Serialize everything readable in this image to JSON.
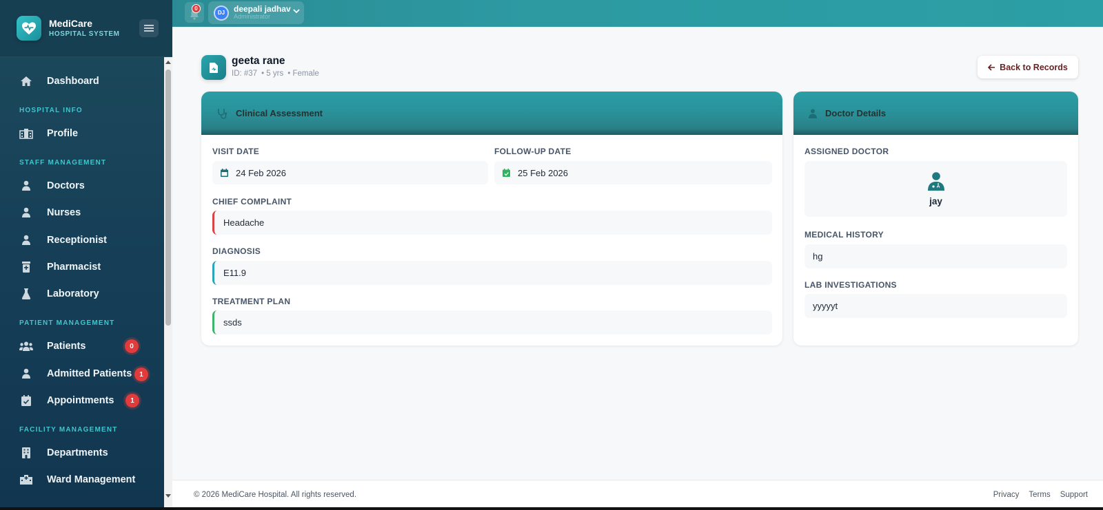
{
  "brand": {
    "name": "MediCare",
    "subtitle": "HOSPITAL SYSTEM"
  },
  "sidebar": {
    "dashboard": "Dashboard",
    "sections": {
      "hospital_info": "HOSPITAL INFO",
      "staff": "STAFF MANAGEMENT",
      "patient": "PATIENT MANAGEMENT",
      "facility": "FACILITY MANAGEMENT"
    },
    "items": {
      "profile": "Profile",
      "doctors": "Doctors",
      "nurses": "Nurses",
      "receptionist": "Receptionist",
      "pharmacist": "Pharmacist",
      "laboratory": "Laboratory",
      "patients": "Patients",
      "admitted": "Admitted Patients",
      "appointments": "Appointments",
      "departments": "Departments",
      "ward": "Ward Management"
    },
    "badges": {
      "patients": "0",
      "admitted": "1",
      "appointments": "1"
    }
  },
  "topbar": {
    "notification_count": "0",
    "user_initials": "DJ",
    "user_name": "deepali jadhav",
    "user_role": "Administrator"
  },
  "patient": {
    "name": "geeta rane",
    "id": "ID: #37",
    "age": "• 5 yrs",
    "gender": "• Female"
  },
  "back_button": "Back to Records",
  "clinical": {
    "title": "Clinical Assessment",
    "visit_date_label": "VISIT DATE",
    "visit_date": "24 Feb 2026",
    "followup_label": "FOLLOW-UP DATE",
    "followup_date": "25 Feb 2026",
    "complaint_label": "CHIEF COMPLAINT",
    "complaint": "Headache",
    "diagnosis_label": "DIAGNOSIS",
    "diagnosis": "E11.9",
    "treatment_label": "TREATMENT PLAN",
    "treatment": "ssds"
  },
  "doctor": {
    "title": "Doctor Details",
    "assigned_label": "ASSIGNED DOCTOR",
    "assigned_name": "jay",
    "history_label": "MEDICAL HISTORY",
    "history": "hg",
    "lab_label": "LAB INVESTIGATIONS",
    "lab": "yyyyyt"
  },
  "footer": {
    "copyright": "© 2026 MediCare Hospital. All rights reserved.",
    "links": [
      "Privacy",
      "Terms",
      "Support"
    ]
  },
  "colors": {
    "teal": "#2b9ea6",
    "complaint_accent": "#d64545",
    "diagnosis_accent": "#2aa6b8",
    "treatment_accent": "#3fb36b",
    "badge_red": "#e23b3b"
  }
}
